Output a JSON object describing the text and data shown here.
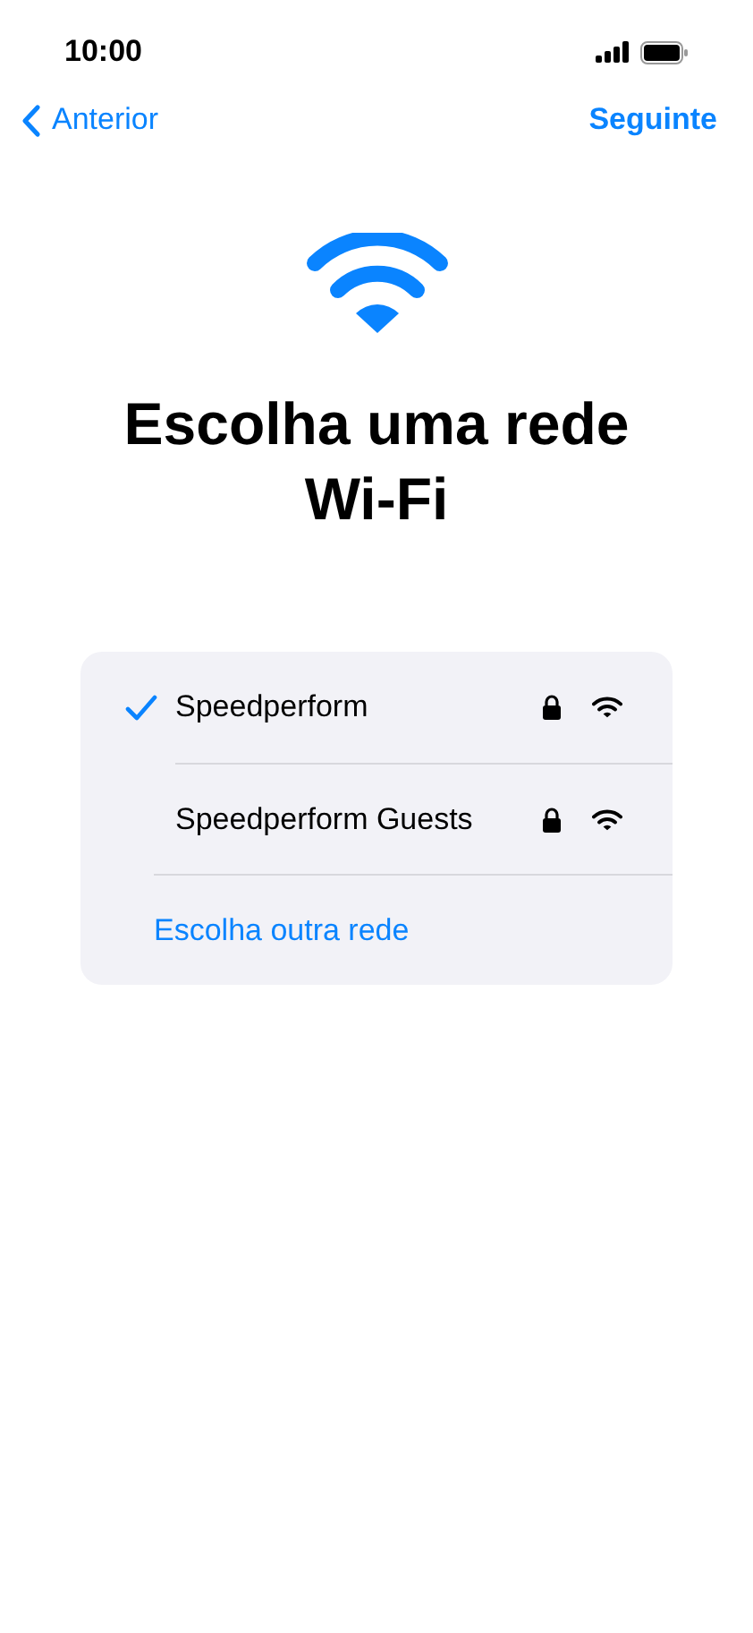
{
  "status_bar": {
    "time": "10:00"
  },
  "nav": {
    "back": "Anterior",
    "next": "Seguinte"
  },
  "title": "Escolha uma rede Wi-Fi",
  "networks": [
    {
      "name": "Speedperform",
      "selected": true,
      "secured": true
    },
    {
      "name": "Speedperform Guests",
      "selected": false,
      "secured": true
    }
  ],
  "other_network": "Escolha outra rede"
}
